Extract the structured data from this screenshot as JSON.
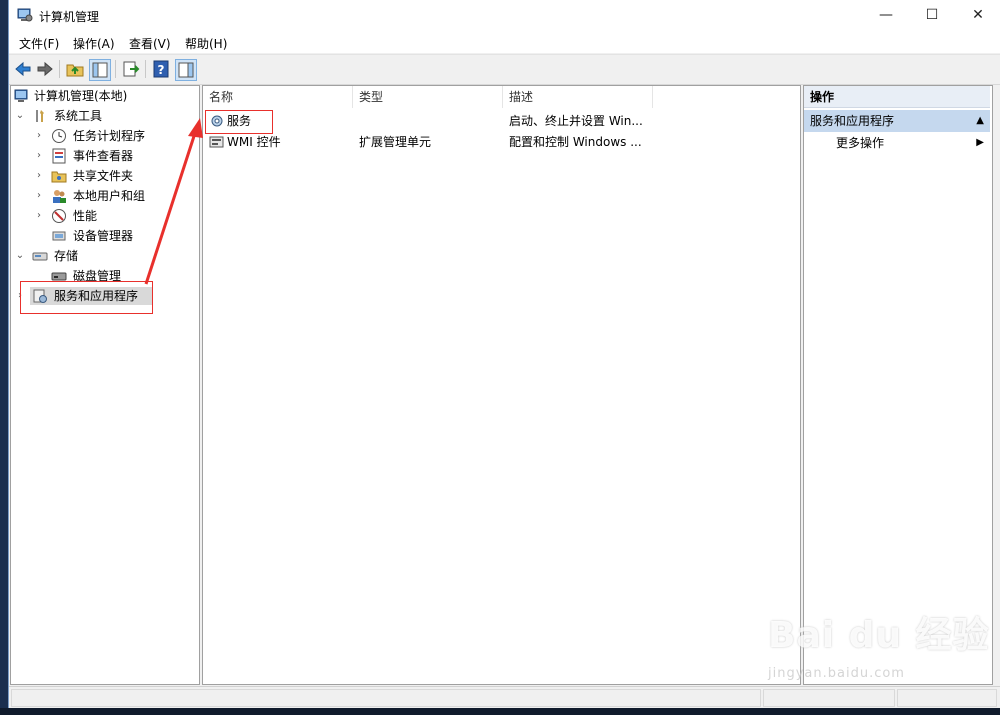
{
  "window": {
    "title": "计算机管理"
  },
  "titlebar_buttons": {
    "minimize": "—",
    "maximize": "☐",
    "close": "✕"
  },
  "menu": [
    "文件(F)",
    "操作(A)",
    "查看(V)",
    "帮助(H)"
  ],
  "tree": {
    "root": "计算机管理(本地)",
    "items": [
      {
        "label": "系统工具",
        "icon": "tools-icon"
      },
      {
        "label": "任务计划程序",
        "icon": "clock-icon"
      },
      {
        "label": "事件查看器",
        "icon": "event-viewer-icon"
      },
      {
        "label": "共享文件夹",
        "icon": "shared-folder-icon"
      },
      {
        "label": "本地用户和组",
        "icon": "users-icon"
      },
      {
        "label": "性能",
        "icon": "performance-icon"
      },
      {
        "label": "设备管理器",
        "icon": "device-manager-icon"
      },
      {
        "label": "存储",
        "icon": "storage-icon"
      },
      {
        "label": "磁盘管理",
        "icon": "disk-icon"
      },
      {
        "label": "服务和应用程序",
        "icon": "services-apps-icon"
      }
    ]
  },
  "list": {
    "columns": [
      "名称",
      "类型",
      "描述"
    ],
    "rows": [
      {
        "name": "服务",
        "type": "",
        "desc": "启动、终止并设置 Win..."
      },
      {
        "name": "WMI 控件",
        "type": "扩展管理单元",
        "desc": "配置和控制 Windows ..."
      }
    ]
  },
  "actions": {
    "header": "操作",
    "group": "服务和应用程序",
    "item": "更多操作"
  },
  "watermark": {
    "brand": "Bai du 经验",
    "url": "jingyan.baidu.com"
  },
  "colors": {
    "highlight_red": "#e8302c",
    "selected_blue": "#c5d8ee"
  }
}
